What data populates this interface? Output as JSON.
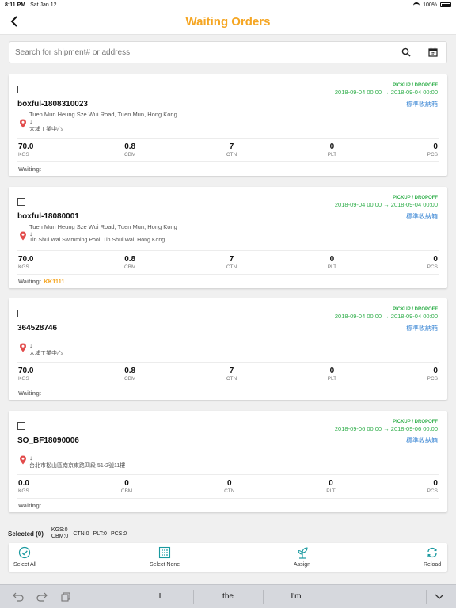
{
  "status_bar": {
    "time": "8:11 PM",
    "date": "Sat Jan 12",
    "battery": "100%"
  },
  "nav": {
    "title": "Waiting Orders"
  },
  "search": {
    "placeholder": "Search for shipment# or address"
  },
  "orders": [
    {
      "id": "boxful-1808310023",
      "pickup_label": "PICKUP / DROPOFF",
      "pickup_range": "2018-09-04 00:00 → 2018-09-04 00:00",
      "container": "標準收納箱",
      "from": "Tuen Mun Heung Sze Wui Road, Tuen Mun, Hong Kong",
      "arrow": "↓",
      "to": "大埔工業中心",
      "kgs": "70.0",
      "cbm": "0.8",
      "ctn": "7",
      "plt": "0",
      "pcs": "0",
      "waiting_label": "Waiting:",
      "waiting_tag": ""
    },
    {
      "id": "boxful-18080001",
      "pickup_label": "PICKUP / DROPOFF",
      "pickup_range": "2018-09-04 00:00 → 2018-09-04 00:00",
      "container": "標準收納箱",
      "from": "Tuen Mun Heung Sze Wui Road, Tuen Mun, Hong Kong",
      "arrow": "↓",
      "to": "Tin Shui Wai Swimming Pool, Tin Shui Wai, Hong Kong",
      "kgs": "70.0",
      "cbm": "0.8",
      "ctn": "7",
      "plt": "0",
      "pcs": "0",
      "waiting_label": "Waiting:",
      "waiting_tag": "KK1111"
    },
    {
      "id": "364528746",
      "pickup_label": "PICKUP / DROPOFF",
      "pickup_range": "2018-09-04 00:00 → 2018-09-04 00:00",
      "container": "標準收納箱",
      "from": "",
      "arrow": "↓",
      "to": "大埔工業中心",
      "kgs": "70.0",
      "cbm": "0.8",
      "ctn": "7",
      "plt": "0",
      "pcs": "0",
      "waiting_label": "Waiting:",
      "waiting_tag": ""
    },
    {
      "id": "SO_BF18090006",
      "pickup_label": "PICKUP / DROPOFF",
      "pickup_range": "2018-09-06 00:00 → 2018-09-06 00:00",
      "container": "標準收納箱",
      "from": "",
      "arrow": "↓",
      "to": "台北市松山區南京東路四段 51-2號11樓",
      "kgs": "0.0",
      "cbm": "0",
      "ctn": "0",
      "plt": "0",
      "pcs": "0",
      "waiting_label": "Waiting:",
      "waiting_tag": ""
    }
  ],
  "units": {
    "kgs": "KGS",
    "cbm": "CBM",
    "ctn": "CTN",
    "plt": "PLT",
    "pcs": "PCS"
  },
  "selected": {
    "label": "Selected (0)",
    "kgs": "KGS:0",
    "cbm": "CBM:0",
    "ctn": "CTN:0",
    "plt": "PLT:0",
    "pcs": "PCS:0"
  },
  "toolbar": {
    "select_all": "Select All",
    "select_none": "Select None",
    "assign": "Assign",
    "reload": "Reload"
  },
  "keyboard": {
    "suggestions": [
      "I",
      "the",
      "I'm"
    ]
  },
  "colors": {
    "accent": "#f5a623",
    "green": "#2fae4a",
    "link": "#3a86d4",
    "teal": "#1a9aa0",
    "pin": "#e24b4b"
  }
}
